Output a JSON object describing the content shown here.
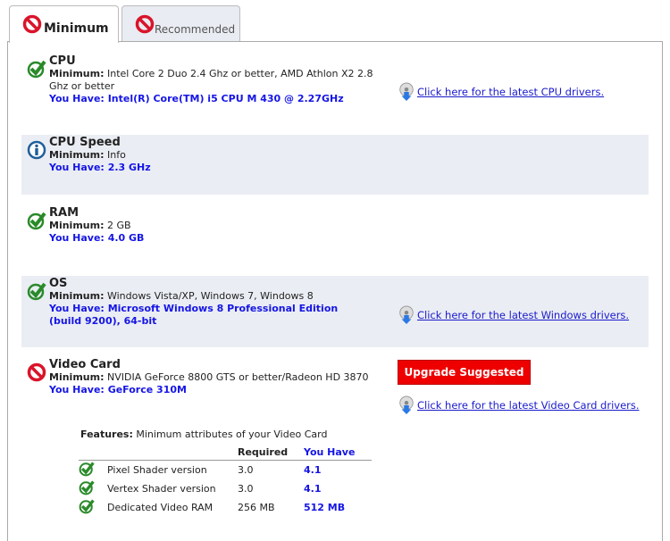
{
  "tabs": [
    {
      "label": "Minimum",
      "status": "fail"
    },
    {
      "label": "Recommended",
      "status": "fail"
    }
  ],
  "minimum_label": "Minimum:",
  "have_label": "You Have:",
  "items": [
    {
      "title": "CPU",
      "status": "pass",
      "minimum": "Intel Core 2 Duo 2.4 Ghz or better, AMD Athlon X2 2.8 Ghz or better",
      "have": "Intel(R) Core(TM) i5 CPU M 430 @ 2.27GHz",
      "link": "Click here for the latest CPU drivers."
    },
    {
      "title": "CPU Speed",
      "status": "info",
      "minimum": "Info",
      "have": "2.3 GHz"
    },
    {
      "title": "RAM",
      "status": "pass",
      "minimum": "2 GB",
      "have": "4.0 GB"
    },
    {
      "title": "OS",
      "status": "pass",
      "minimum": "Windows Vista/XP, Windows 7, Windows 8",
      "have": "Microsoft Windows 8 Professional Edition (build 9200), 64-bit",
      "link": "Click here for the latest Windows drivers."
    },
    {
      "title": "Video Card",
      "status": "fail",
      "minimum": "NVIDIA GeForce 8800 GTS or better/Radeon HD 3870",
      "have": "GeForce 310M",
      "button": "Upgrade Suggested",
      "link": "Click here for the latest Video Card drivers."
    }
  ],
  "features": {
    "label": "Features:",
    "description": "Minimum attributes of your Video Card",
    "headers": {
      "required": "Required",
      "have": "You Have"
    },
    "rows": [
      {
        "name": "Pixel Shader version",
        "required": "3.0",
        "have": "4.1",
        "status": "pass"
      },
      {
        "name": "Vertex Shader version",
        "required": "3.0",
        "have": "4.1",
        "status": "pass"
      },
      {
        "name": "Dedicated Video RAM",
        "required": "256 MB",
        "have": "512 MB",
        "status": "pass"
      }
    ]
  },
  "colors": {
    "pass": "#2a8a2a",
    "fail": "#d9142b",
    "info": "#1f5f9a",
    "have": "#1515e6",
    "upgrade": "#e00000"
  }
}
